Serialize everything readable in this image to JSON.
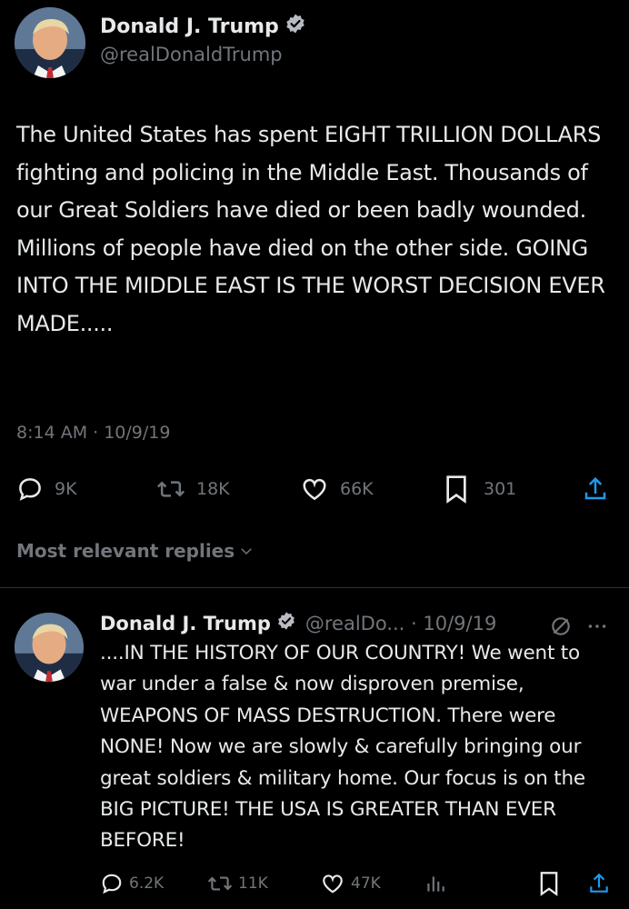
{
  "main_tweet": {
    "author": {
      "name": "Donald J. Trump",
      "handle": "@realDonaldTrump",
      "avatar_icon": "profile-photo",
      "verified_icon": "verified-badge-icon"
    },
    "text": "The United States has spent EIGHT TRILLION DOLLARS fighting and policing in the Middle East. Thousands of our Great Soldiers have died or been badly wounded. Millions of people have died on the other side. GOING INTO THE MIDDLE EAST IS THE WORST DECISION EVER MADE.....",
    "timestamp": "8:14 AM · 10/9/19",
    "actions": {
      "replies": "9K",
      "retweets": "18K",
      "likes": "66K",
      "bookmarks": "301"
    }
  },
  "replies_header": {
    "label": "Most relevant replies",
    "icon": "chevron-down-icon"
  },
  "reply_tweet": {
    "author": {
      "name": "Donald J. Trump",
      "handle_date": "@realDo... · 10/9/19",
      "avatar_icon": "profile-photo",
      "verified_icon": "verified-badge-icon"
    },
    "text": "....IN THE HISTORY OF OUR COUNTRY! We went to war under a false & now disproven premise, WEAPONS OF MASS DESTRUCTION. There were NONE! Now we are slowly & carefully bringing our great soldiers & military home. Our focus is on the BIG PICTURE! THE USA IS GREATER THAN EVER BEFORE!",
    "actions": {
      "replies": "6.2K",
      "retweets": "11K",
      "likes": "47K"
    }
  },
  "colors": {
    "background": "#000000",
    "text_primary": "#e7e9ea",
    "text_secondary": "#71767b",
    "verified_blue": "#1d9bf0",
    "divider": "#2f3336"
  }
}
